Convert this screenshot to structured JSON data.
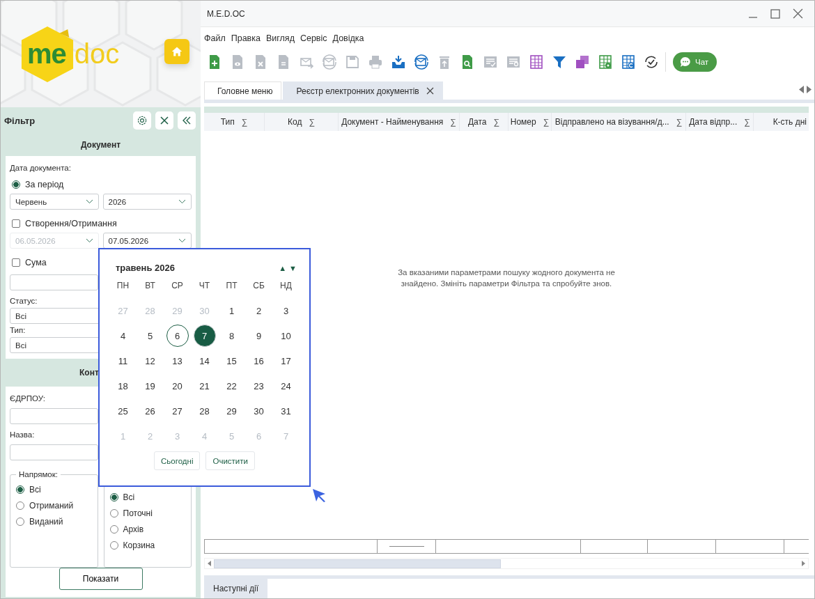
{
  "window": {
    "title": "M.E.D.OC"
  },
  "logo": {
    "left": "me",
    "right": "doc"
  },
  "filter": {
    "title": "Фільтр",
    "document_section": {
      "title": "Документ",
      "date_label": "Дата документа:",
      "period": {
        "label": "За період",
        "selected": true
      },
      "month": "Червень",
      "year": "2026",
      "created": {
        "label": "Створення/Отримання",
        "checked": false
      },
      "date_from": {
        "value": "06.05.2026",
        "disabled": true
      },
      "date_to": {
        "value": "07.05.2026",
        "disabled": false
      },
      "sum": {
        "label": "Сума",
        "checked": false
      },
      "status_label": "Статус:",
      "status": "Всі",
      "type_label": "Тип:",
      "type": "Всі"
    },
    "counterparty_section": {
      "title": "Конт",
      "edrpou_label": "ЄДРПОУ:",
      "name_label": "Назва:",
      "direction": {
        "legend": "Напрямок:",
        "options": [
          {
            "label": "Всі",
            "selected": true
          },
          {
            "label": "Отриманий",
            "selected": false
          },
          {
            "label": "Виданий",
            "selected": false
          }
        ]
      },
      "location": {
        "options": [
          {
            "label": "Всі",
            "selected": true
          },
          {
            "label": "Поточні",
            "selected": false
          },
          {
            "label": "Архів",
            "selected": false
          },
          {
            "label": "Корзина",
            "selected": false
          }
        ]
      }
    },
    "show_button": "Показати"
  },
  "menu": [
    "Файл",
    "Правка",
    "Вигляд",
    "Сервіс",
    "Довідка"
  ],
  "toolbar": [
    {
      "kind": "doc-plus",
      "disabled": false
    },
    {
      "kind": "doc-eye",
      "disabled": true
    },
    {
      "kind": "doc-x",
      "disabled": true
    },
    {
      "kind": "doc-copy",
      "disabled": true
    },
    {
      "kind": "mail-forward",
      "disabled": true
    },
    {
      "kind": "mail-refresh",
      "disabled": true
    },
    {
      "kind": "save",
      "disabled": true
    },
    {
      "kind": "print",
      "disabled": true
    },
    {
      "kind": "inbox",
      "disabled": false
    },
    {
      "kind": "mail-sync",
      "disabled": false
    },
    {
      "kind": "trash-up",
      "disabled": true
    },
    {
      "kind": "doc-search",
      "disabled": false
    },
    {
      "kind": "list-check",
      "disabled": true
    },
    {
      "kind": "list-refresh",
      "disabled": true
    },
    {
      "kind": "grid",
      "disabled": false
    },
    {
      "kind": "filter",
      "disabled": false
    },
    {
      "kind": "layers",
      "disabled": false
    },
    {
      "kind": "grid-gear",
      "disabled": false
    },
    {
      "kind": "grid-refresh",
      "disabled": false
    },
    {
      "kind": "sync-check",
      "disabled": false
    }
  ],
  "chat_button": "Чат",
  "tabs": [
    {
      "label": "Головне меню",
      "selected": false,
      "closable": false
    },
    {
      "label": "Реєстр електронних документів",
      "selected": true,
      "closable": true
    }
  ],
  "table": {
    "columns": [
      {
        "label": "Тип",
        "sigma": "∑"
      },
      {
        "label": "Код",
        "sigma": "∑"
      },
      {
        "label": "Документ - Найменування",
        "sigma": "∑"
      },
      {
        "label": "Дата",
        "sigma": "∑"
      },
      {
        "label": "Номер",
        "sigma": "∑"
      },
      {
        "label": "Відправлено на  візування/д...",
        "sigma": "∑"
      },
      {
        "label": "Дата відпр...",
        "sigma": "∑"
      },
      {
        "label": "К-сть дні"
      }
    ],
    "empty_message": "За вказаними параметрами пошуку жодного документа не знайдено. Змініть параметри Фільтра та спробуйте знов."
  },
  "bottom_tabs": [
    {
      "label": "Наступні дії",
      "selected": true
    }
  ],
  "calendar": {
    "title": "травень 2026",
    "prev": "▲",
    "next": "▼",
    "weekdays": [
      "ПН",
      "ВТ",
      "СР",
      "ЧТ",
      "ПТ",
      "СБ",
      "НД"
    ],
    "days": [
      {
        "day": "27",
        "outside": true,
        "selected": false,
        "marked": false
      },
      {
        "day": "28",
        "outside": true,
        "selected": false,
        "marked": false
      },
      {
        "day": "29",
        "outside": true,
        "selected": false,
        "marked": false
      },
      {
        "day": "30",
        "outside": true,
        "selected": false,
        "marked": false
      },
      {
        "day": "1",
        "outside": false,
        "selected": false,
        "marked": false
      },
      {
        "day": "2",
        "outside": false,
        "selected": false,
        "marked": false
      },
      {
        "day": "3",
        "outside": false,
        "selected": false,
        "marked": false
      },
      {
        "day": "4",
        "outside": false,
        "selected": false,
        "marked": false
      },
      {
        "day": "5",
        "outside": false,
        "selected": false,
        "marked": false
      },
      {
        "day": "6",
        "outside": false,
        "selected": false,
        "marked": true
      },
      {
        "day": "7",
        "outside": false,
        "selected": true,
        "marked": false
      },
      {
        "day": "8",
        "outside": false,
        "selected": false,
        "marked": false
      },
      {
        "day": "9",
        "outside": false,
        "selected": false,
        "marked": false
      },
      {
        "day": "10",
        "outside": false,
        "selected": false,
        "marked": false
      },
      {
        "day": "11",
        "outside": false,
        "selected": false,
        "marked": false
      },
      {
        "day": "12",
        "outside": false,
        "selected": false,
        "marked": false
      },
      {
        "day": "13",
        "outside": false,
        "selected": false,
        "marked": false
      },
      {
        "day": "14",
        "outside": false,
        "selected": false,
        "marked": false
      },
      {
        "day": "15",
        "outside": false,
        "selected": false,
        "marked": false
      },
      {
        "day": "16",
        "outside": false,
        "selected": false,
        "marked": false
      },
      {
        "day": "17",
        "outside": false,
        "selected": false,
        "marked": false
      },
      {
        "day": "18",
        "outside": false,
        "selected": false,
        "marked": false
      },
      {
        "day": "19",
        "outside": false,
        "selected": false,
        "marked": false
      },
      {
        "day": "20",
        "outside": false,
        "selected": false,
        "marked": false
      },
      {
        "day": "21",
        "outside": false,
        "selected": false,
        "marked": false
      },
      {
        "day": "22",
        "outside": false,
        "selected": false,
        "marked": false
      },
      {
        "day": "23",
        "outside": false,
        "selected": false,
        "marked": false
      },
      {
        "day": "24",
        "outside": false,
        "selected": false,
        "marked": false
      },
      {
        "day": "25",
        "outside": false,
        "selected": false,
        "marked": false
      },
      {
        "day": "26",
        "outside": false,
        "selected": false,
        "marked": false
      },
      {
        "day": "27",
        "outside": false,
        "selected": false,
        "marked": false
      },
      {
        "day": "28",
        "outside": false,
        "selected": false,
        "marked": false
      },
      {
        "day": "29",
        "outside": false,
        "selected": false,
        "marked": false
      },
      {
        "day": "30",
        "outside": false,
        "selected": false,
        "marked": false
      },
      {
        "day": "31",
        "outside": false,
        "selected": false,
        "marked": false
      },
      {
        "day": "1",
        "outside": true,
        "selected": false,
        "marked": false
      },
      {
        "day": "2",
        "outside": true,
        "selected": false,
        "marked": false
      },
      {
        "day": "3",
        "outside": true,
        "selected": false,
        "marked": false
      },
      {
        "day": "4",
        "outside": true,
        "selected": false,
        "marked": false
      },
      {
        "day": "5",
        "outside": true,
        "selected": false,
        "marked": false
      },
      {
        "day": "6",
        "outside": true,
        "selected": false,
        "marked": false
      },
      {
        "day": "7",
        "outside": true,
        "selected": false,
        "marked": false
      }
    ],
    "buttons": [
      "Сьогодні",
      "Очистити"
    ]
  }
}
